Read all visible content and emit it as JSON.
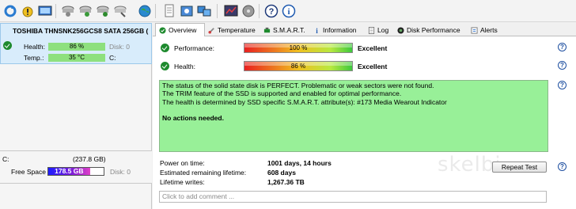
{
  "toolbar": {
    "buttons": [
      "refresh-icon",
      "warning-icon",
      "monitor-icon",
      "disk-power-icon",
      "disk-power-icon-2",
      "disk-settings-icon",
      "disk-tool-icon",
      "globe-icon",
      "document-icon",
      "settings-icon",
      "network-icon",
      "benchmark-icon",
      "disk-icon",
      "help-icon",
      "info-icon"
    ]
  },
  "left_panel": {
    "disk_title": "TOSHIBA THNSNK256GCS8 SATA 256GB (",
    "health_label": "Health:",
    "health_value": "86 %",
    "disk_label": "Disk: 0",
    "temp_label": "Temp.:",
    "temp_value": "35 °C",
    "drive_letter": "C:",
    "partition": {
      "name": "C:",
      "size": "(237.8 GB)",
      "free_label": "Free Space",
      "free_value": "178.5 GB",
      "free_fraction": 0.75,
      "disk_label": "Disk: 0"
    }
  },
  "tabs": [
    "Overview",
    "Temperature",
    "S.M.A.R.T.",
    "Information",
    "Log",
    "Disk Performance",
    "Alerts"
  ],
  "overview": {
    "performance_label": "Performance:",
    "performance_value": "100 %",
    "performance_rating": "Excellent",
    "health_label": "Health:",
    "health_value": "86 %",
    "health_rating": "Excellent",
    "message_lines": [
      "The status of the solid state disk is PERFECT. Problematic or weak sectors were not found.",
      "The TRIM feature of the SSD is supported and enabled for optimal performance.",
      "The health is determined by SSD specific S.M.A.R.T. attribute(s):  #173 Media Wearout Indicator"
    ],
    "action_text": "No actions needed.",
    "power_on_label": "Power on time:",
    "power_on_value": "1001 days, 14 hours",
    "remaining_label": "Estimated remaining lifetime:",
    "remaining_value": "608 days",
    "writes_label": "Lifetime writes:",
    "writes_value": "1,267.36 TB",
    "repeat_button": "Repeat Test",
    "comment_placeholder": "Click to add comment ...",
    "watermark": "skelbi"
  },
  "colors": {
    "accent": "#1e8a2e",
    "message_bg": "#98f098",
    "selected_disk_bg": "#d8ecfb"
  }
}
